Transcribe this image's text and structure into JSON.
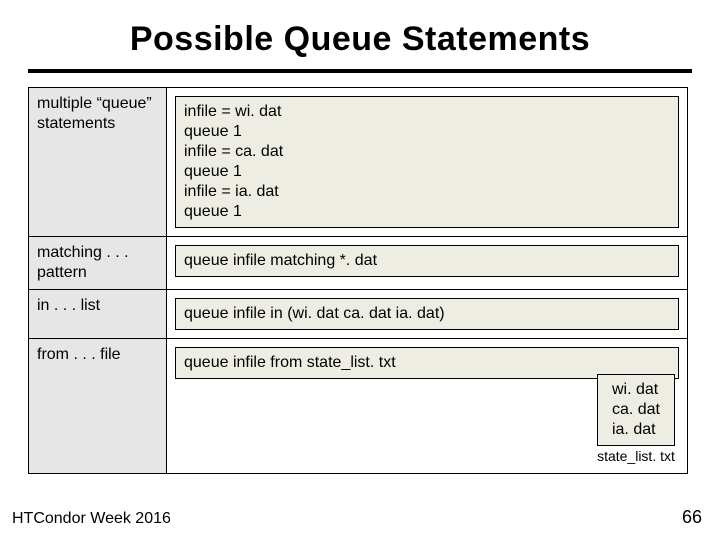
{
  "slide": {
    "title": "Possible Queue Statements",
    "rows": [
      {
        "label": "multiple “queue” statements",
        "code": "infile = wi. dat\nqueue 1\ninfile = ca. dat\nqueue 1\ninfile = ia. dat\nqueue 1"
      },
      {
        "label": "matching . . . pattern",
        "code": "queue infile matching *. dat"
      },
      {
        "label": "in . . . list",
        "code": "queue infile in (wi. dat ca. dat ia. dat)"
      },
      {
        "label": "from . . . file",
        "code": "queue infile from state_list. txt",
        "file_contents": "wi. dat\nca. dat\nia. dat",
        "file_caption": "state_list. txt"
      }
    ],
    "footer_left": "HTCondor Week 2016",
    "page_number": "66"
  }
}
